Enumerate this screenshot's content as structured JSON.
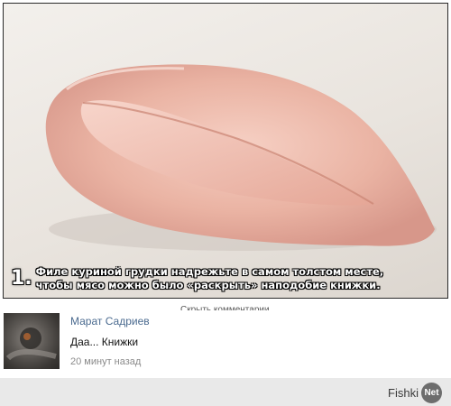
{
  "post": {
    "image_alt": "chicken-breast-photo",
    "step_number": "1.",
    "caption_line1": "Филе куриной грудки надрежьте в самом толстом месте,",
    "caption_line2": "чтобы мясо можно было «раскрыть» наподобие книжки."
  },
  "comments": {
    "hide_label": "Скрыть комментарии",
    "items": [
      {
        "author": "Марат Садриев",
        "text": "Даа... Книжки",
        "time": "20 минут назад"
      }
    ]
  },
  "watermark": {
    "word": "Fishki",
    "badge": "Net"
  },
  "colors": {
    "author_link": "#4a6a8f",
    "meat_light": "#f2c4b8",
    "meat_dark": "#d99a8c",
    "footer_bg": "#e9e9e9"
  }
}
